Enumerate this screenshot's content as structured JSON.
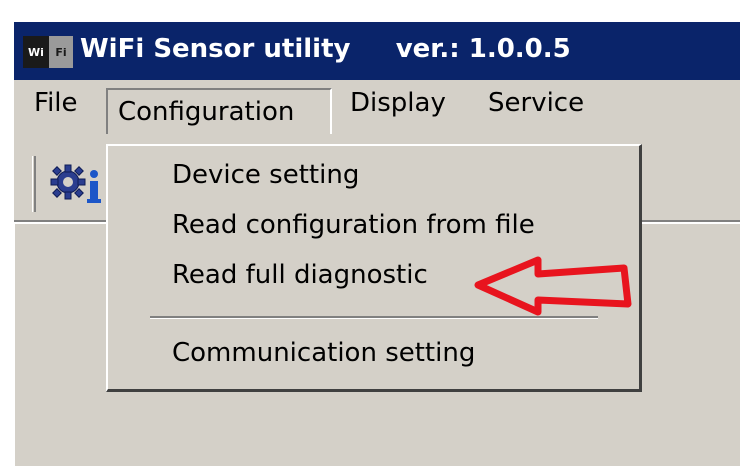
{
  "window": {
    "title": "WiFi Sensor utility     ver.: 1.0.0.5",
    "icon_text_left": "Wi",
    "icon_text_right": "Fi",
    "icon": "wifi-app-icon"
  },
  "menubar": {
    "items": [
      {
        "label": "File"
      },
      {
        "label": "Configuration"
      },
      {
        "label": "Display"
      },
      {
        "label": "Service"
      }
    ]
  },
  "toolbar": {
    "buttons": [
      {
        "icon": "gear-info-icon"
      }
    ]
  },
  "configuration_menu": {
    "items": [
      {
        "label": "Device setting"
      },
      {
        "label": "Read configuration from file"
      },
      {
        "label": "Read full diagnostic"
      },
      {
        "label": "Communication setting"
      }
    ]
  },
  "annotation": {
    "arrow_color": "#e8141e",
    "points_to": "Read full diagnostic"
  },
  "colors": {
    "titlebar": "#0a246a",
    "window_bg": "#d4d0c8"
  }
}
